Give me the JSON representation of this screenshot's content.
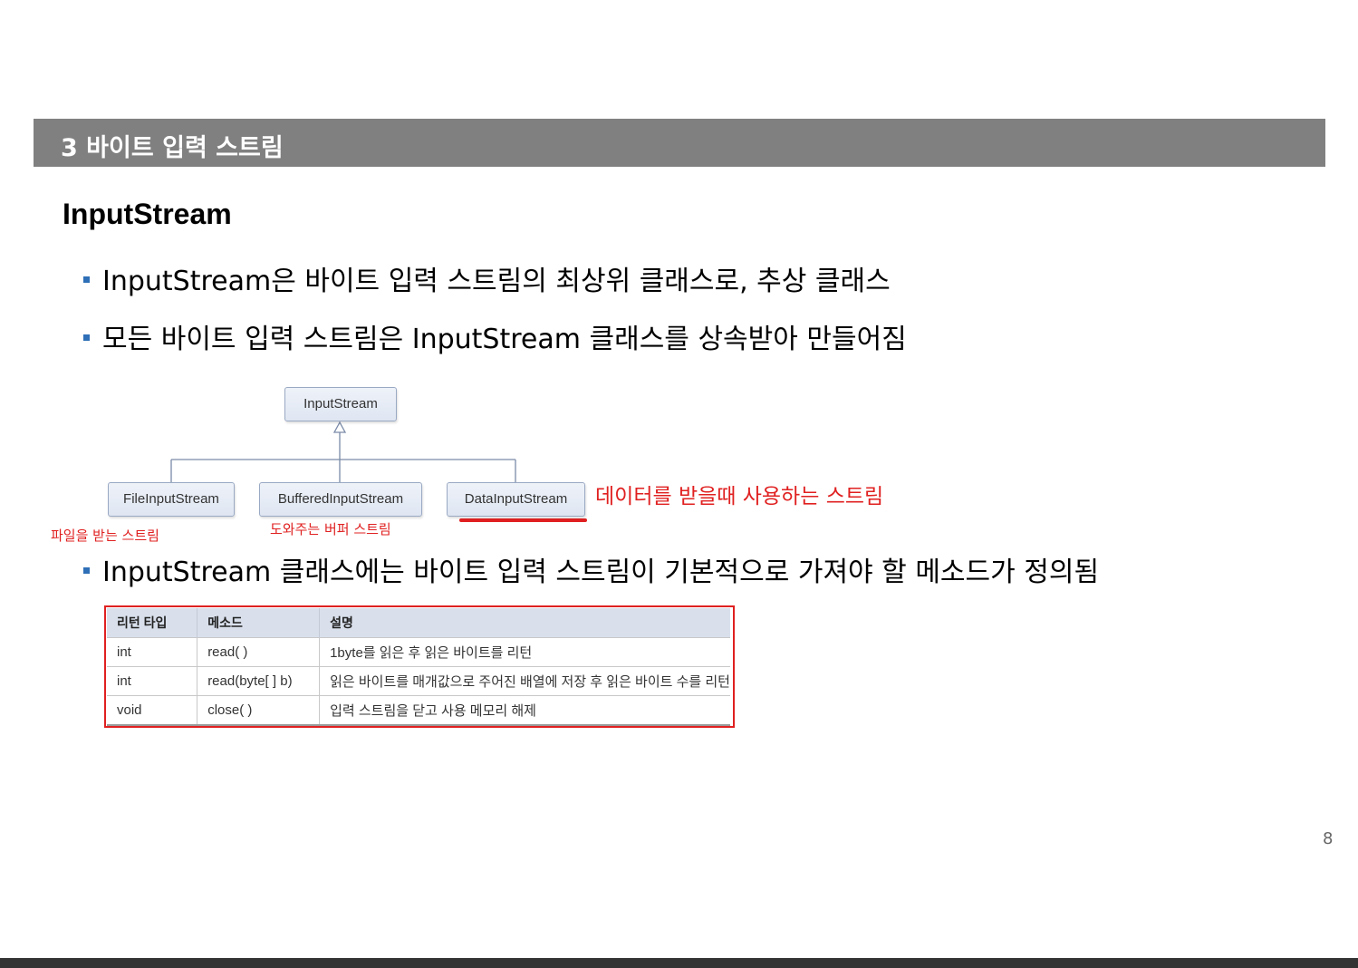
{
  "header": {
    "title": "3 바이트 입력 스트림"
  },
  "section": {
    "title": "InputStream"
  },
  "bullets": [
    "InputStream은 바이트 입력 스트림의 최상위 클래스로, 추상 클래스",
    "모든 바이트 입력 스트림은 InputStream 클래스를 상속받아 만들어짐",
    "InputStream 클래스에는 바이트 입력 스트림이 기본적으로 가져야 할 메소드가 정의됨"
  ],
  "diagram": {
    "parent": "InputStream",
    "children": [
      "FileInputStream",
      "BufferedInputStream",
      "DataInputStream"
    ],
    "notes": {
      "data": "데이터를 받을때 사용하는 스트림",
      "file": "파일을 받는 스트림",
      "buffer": "도와주는 버퍼 스트림"
    },
    "accent_color": "#e02020"
  },
  "table": {
    "headers": [
      "리턴 타입",
      "메소드",
      "설명"
    ],
    "rows": [
      [
        "int",
        "read( )",
        "1byte를 읽은 후 읽은 바이트를 리턴"
      ],
      [
        "int",
        "read(byte[ ] b)",
        "읽은 바이트를 매개값으로 주어진 배열에 저장 후 읽은 바이트 수를 리턴"
      ],
      [
        "void",
        "close( )",
        "입력 스트림을 닫고 사용 메모리 해제"
      ]
    ]
  },
  "page_number": "8",
  "colors": {
    "header_bar": "#808080",
    "bullet": "#2e6fb7",
    "highlight": "#e02020"
  }
}
